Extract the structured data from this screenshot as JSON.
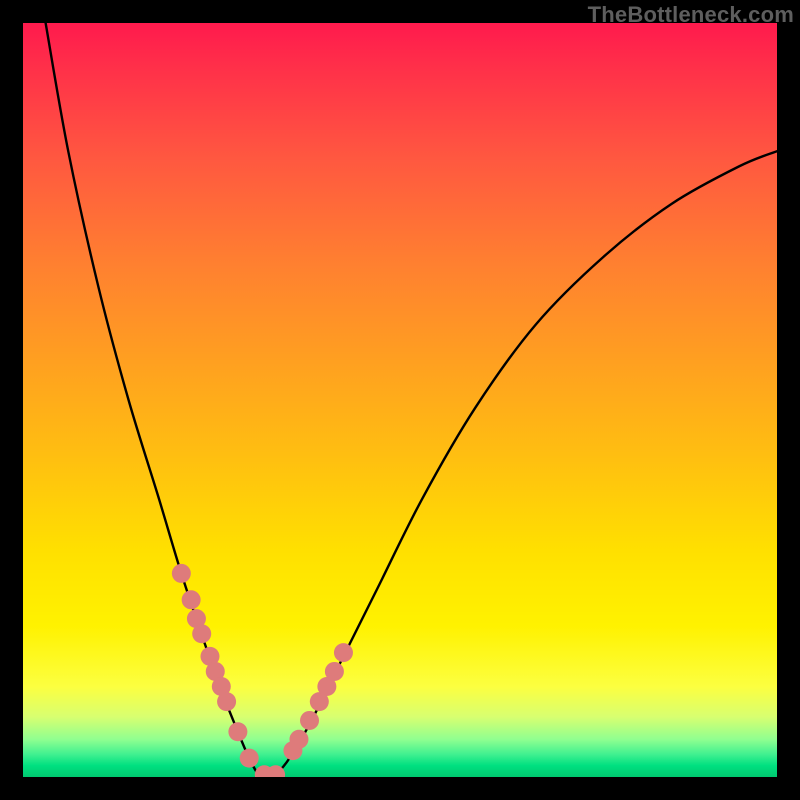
{
  "watermark": "TheBottleneck.com",
  "chart_data": {
    "type": "line",
    "title": "",
    "xlabel": "",
    "ylabel": "",
    "xlim": [
      0,
      100
    ],
    "ylim": [
      0,
      100
    ],
    "series": [
      {
        "name": "bottleneck-curve",
        "x": [
          3,
          6,
          10,
          14,
          18,
          21,
          24,
          26.5,
          28.5,
          30,
          31.5,
          33,
          35,
          38,
          42,
          47,
          53,
          60,
          68,
          77,
          86,
          95,
          100
        ],
        "y": [
          100,
          83,
          65,
          50,
          37,
          27,
          18,
          11,
          6,
          2.5,
          0,
          0,
          2,
          7,
          15,
          25,
          37,
          49,
          60,
          69,
          76,
          81,
          83
        ]
      }
    ],
    "markers": {
      "name": "highlight-points",
      "color": "#de7b7b",
      "x": [
        21.0,
        22.3,
        23.0,
        23.7,
        24.8,
        25.5,
        26.3,
        27.0,
        28.5,
        30.0,
        32.0,
        33.5,
        35.8,
        36.6,
        38.0,
        39.3,
        40.3,
        41.3,
        42.5
      ],
      "y": [
        27.0,
        23.5,
        21.0,
        19.0,
        16.0,
        14.0,
        12.0,
        10.0,
        6.0,
        2.5,
        0.3,
        0.3,
        3.5,
        5.0,
        7.5,
        10.0,
        12.0,
        14.0,
        16.5
      ]
    }
  }
}
